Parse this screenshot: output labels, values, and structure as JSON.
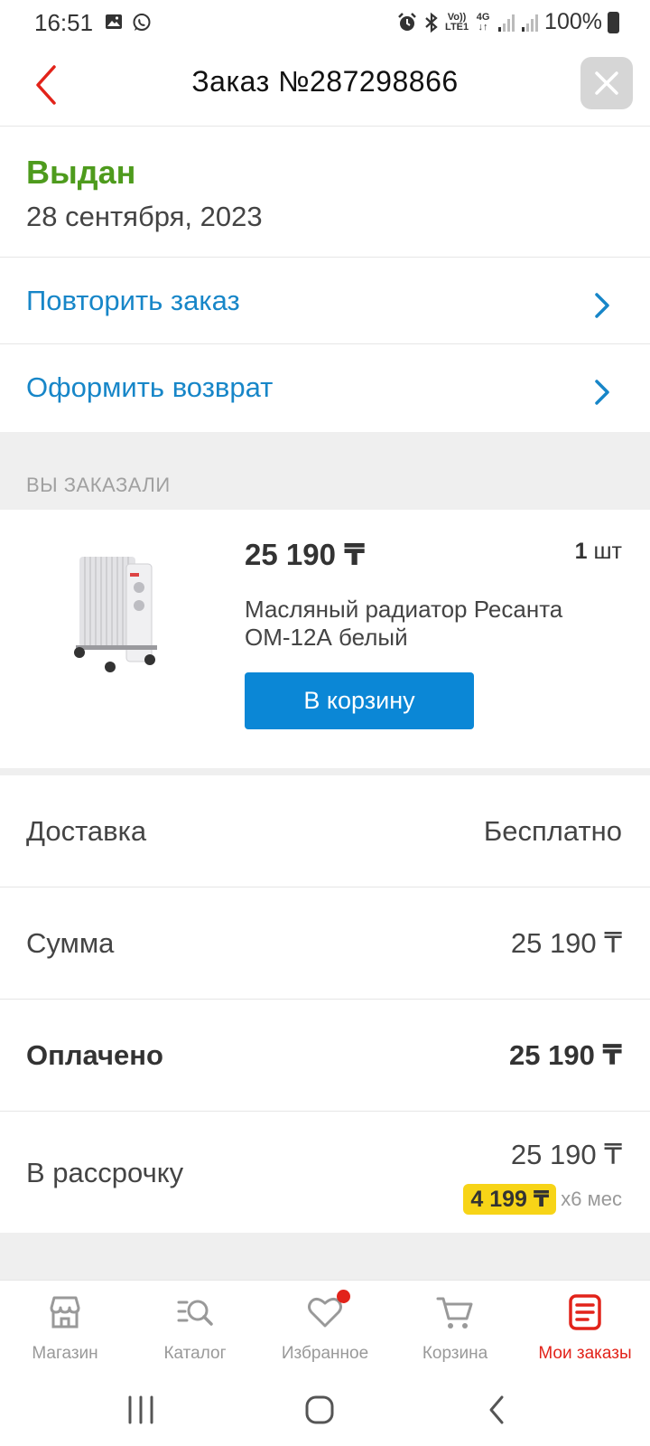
{
  "status_bar": {
    "time": "16:51",
    "left_icons": [
      "image-icon",
      "whatsapp-icon"
    ],
    "right_icons": [
      "alarm-icon",
      "bluetooth-icon",
      "volte-icon",
      "4g-icon",
      "signal-icon",
      "signal-icon",
      "battery-icon"
    ],
    "volte_text": "Vo)) LTE1",
    "network_text": "4G",
    "battery": "100%"
  },
  "header": {
    "title": "Заказ №287298866",
    "back_icon": "chevron-left-icon",
    "close_icon": "close-icon"
  },
  "order_status": {
    "status": "Выдан",
    "date": "28 сентября, 2023"
  },
  "actions": [
    {
      "label": "Повторить заказ",
      "icon": "chevron-right-icon"
    },
    {
      "label": "Оформить возврат",
      "icon": "chevron-right-icon"
    }
  ],
  "ordered_section": {
    "title": "ВЫ ЗАКАЗАЛИ"
  },
  "product": {
    "price": "25 190 ₸",
    "qty_number": "1",
    "qty_unit": "шт",
    "name": "Масляный радиатор Ресанта ОМ-12А белый",
    "cart_button": "В корзину",
    "image": "oil-radiator-image"
  },
  "summary": {
    "delivery_label": "Доставка",
    "delivery_value": "Бесплатно",
    "sum_label": "Сумма",
    "sum_value": "25 190 ₸",
    "paid_label": "Оплачено",
    "paid_value": "25 190 ₸",
    "installment_label": "В рассрочку",
    "installment_total": "25 190 ₸",
    "installment_monthly": "4 199 ₸",
    "installment_suffix": "x6 мес"
  },
  "tabs": [
    {
      "label": "Магазин",
      "icon": "store-icon",
      "active": false
    },
    {
      "label": "Каталог",
      "icon": "catalog-search-icon",
      "active": false
    },
    {
      "label": "Избранное",
      "icon": "heart-icon",
      "active": false,
      "badge": true
    },
    {
      "label": "Корзина",
      "icon": "cart-icon",
      "active": false
    },
    {
      "label": "Мои заказы",
      "icon": "orders-icon",
      "active": true
    }
  ],
  "colors": {
    "accent_red": "#e2231a",
    "link_blue": "#1786c8",
    "button_blue": "#0b87d6",
    "status_green": "#4e9b1d",
    "installment_yellow": "#f7d417"
  }
}
